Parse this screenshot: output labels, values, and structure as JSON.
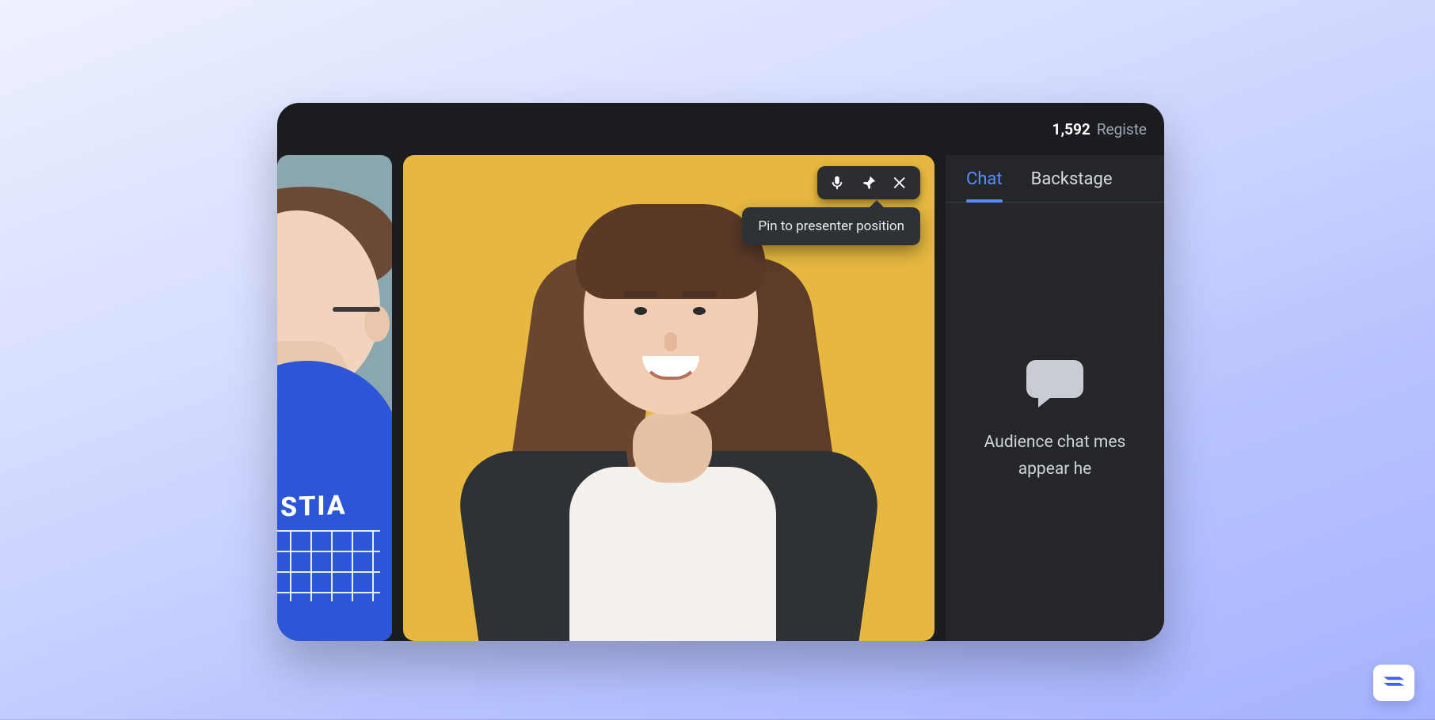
{
  "header": {
    "count": "1,592",
    "count_label": "Registe"
  },
  "video_controls": {
    "tooltip": "Pin to presenter position",
    "icons": {
      "mic": "microphone-icon",
      "pin": "pin-icon",
      "close": "close-icon"
    }
  },
  "participants": {
    "left_shirt_text": "STIA"
  },
  "side_panel": {
    "tabs": [
      {
        "id": "chat",
        "label": "Chat",
        "active": true
      },
      {
        "id": "backstage",
        "label": "Backstage",
        "active": false
      }
    ],
    "chat_empty": {
      "line1": "Audience chat mes",
      "line2": "appear he"
    }
  },
  "colors": {
    "accent": "#5b8bff",
    "panel": "#24262a",
    "window": "#1a1c1f",
    "main_tile_bg": "#e6b83f"
  }
}
